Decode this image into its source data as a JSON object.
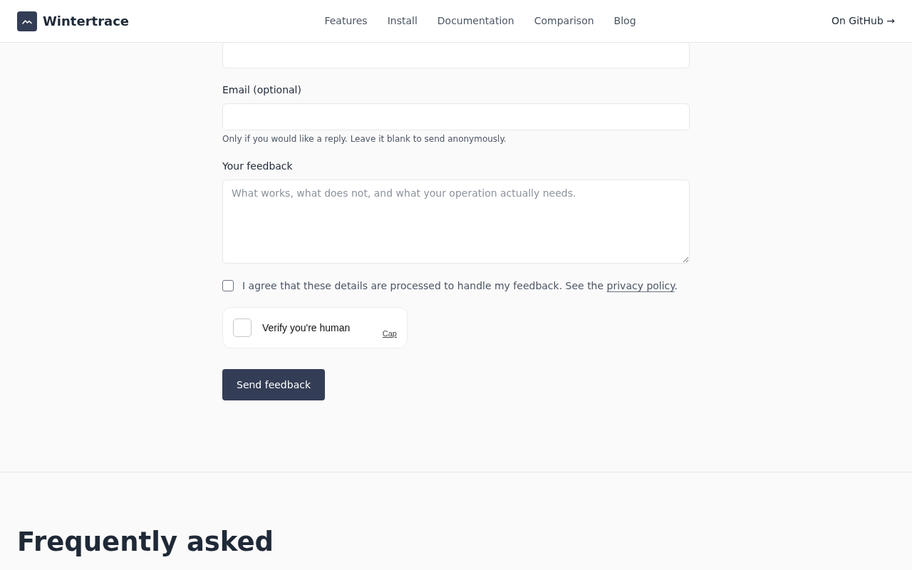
{
  "header": {
    "brand": "Wintertrace",
    "nav": [
      {
        "label": "Features"
      },
      {
        "label": "Install"
      },
      {
        "label": "Documentation"
      },
      {
        "label": "Comparison"
      },
      {
        "label": "Blog"
      }
    ],
    "github_link": "On GitHub →"
  },
  "form": {
    "fields": [
      {
        "kind": "input"
      },
      {
        "kind": "input",
        "label": "Email (optional)",
        "hint": "Only if you would like a reply. Leave it blank to send anonymously."
      },
      {
        "kind": "textarea",
        "label": "Your feedback",
        "placeholder": "What works, what does not, and what your operation actually needs."
      }
    ],
    "consent": {
      "checked": false,
      "text_before": "I agree that these details are processed to handle my feedback. See the ",
      "link": "privacy policy",
      "text_after": "."
    },
    "captcha": {
      "checked": false,
      "label": "Verify you're human",
      "brand": "Cap"
    },
    "submit": "Send feedback"
  },
  "faq": {
    "title": "Frequently asked"
  }
}
